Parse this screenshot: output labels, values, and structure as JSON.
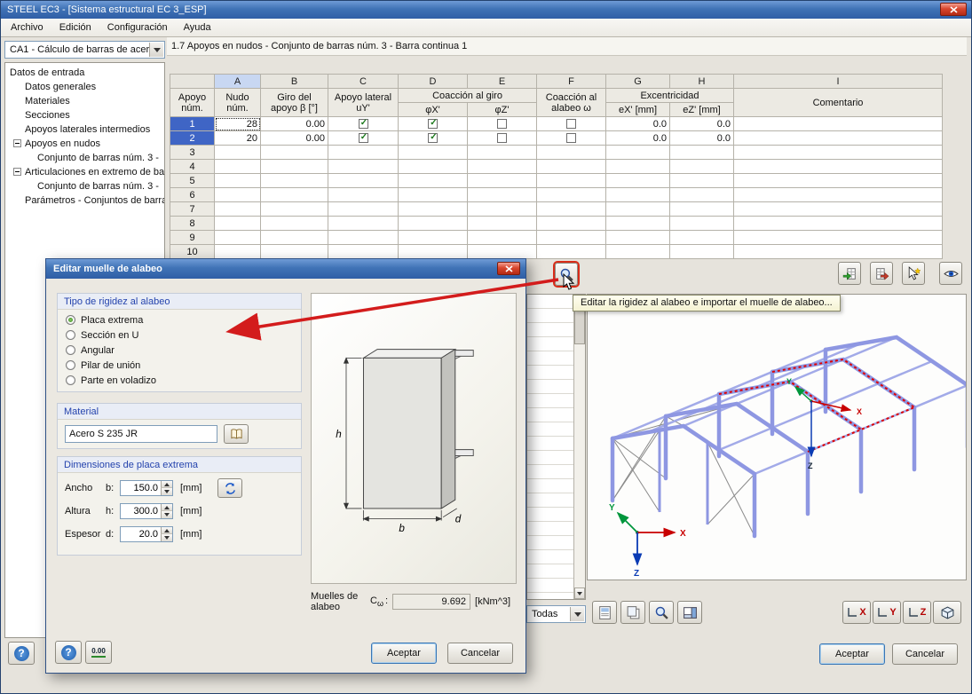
{
  "window": {
    "title": "STEEL EC3 - [Sistema estructural EC 3_ESP]"
  },
  "icons": {
    "help": "?"
  },
  "menu": {
    "items": [
      "Archivo",
      "Edición",
      "Configuración",
      "Ayuda"
    ]
  },
  "sidebar": {
    "case_selector": "CA1 - Cálculo de barras de acer",
    "tree_root": "Datos de entrada",
    "items": [
      {
        "label": "Datos generales"
      },
      {
        "label": "Materiales"
      },
      {
        "label": "Secciones"
      },
      {
        "label": "Apoyos laterales intermedios"
      },
      {
        "label": "Apoyos en nudos"
      },
      {
        "label": "Conjunto de barras núm. 3 -"
      },
      {
        "label": "Articulaciones en extremo de ba"
      },
      {
        "label": "Conjunto de barras núm. 3 -"
      },
      {
        "label": "Parámetros - Conjuntos de barra"
      }
    ]
  },
  "main": {
    "section_title": "1.7 Apoyos en nudos - Conjunto de barras núm. 3 - Barra continua 1",
    "filter_all": "Todas",
    "tooltip": "Editar la rigidez al alabeo e importar el muelle de alabeo...",
    "buttons": {
      "ok": "Aceptar",
      "cancel": "Cancelar"
    }
  },
  "table": {
    "letters": [
      "A",
      "B",
      "C",
      "D",
      "E",
      "F",
      "G",
      "H",
      "I"
    ],
    "headers": {
      "apoyo": [
        "Apoyo",
        "núm."
      ],
      "nudo": [
        "Nudo",
        "núm."
      ],
      "giro": [
        "Giro del",
        "apoyo β [°]"
      ],
      "lateral": [
        "Apoyo lateral",
        "uY'"
      ],
      "coaccion_giro": "Coacción al giro",
      "phi_x": "φX'",
      "phi_z": "φZ'",
      "alabeo": [
        "Coacción al",
        "alabeo ω"
      ],
      "excentricidad": "Excentricidad",
      "e_x": "eX' [mm]",
      "e_z": "eZ' [mm]",
      "comentario": "Comentario"
    },
    "rows": [
      {
        "num": "1",
        "nudo": "28",
        "giro": "0.00",
        "uy": true,
        "phix": true,
        "phiz": false,
        "omega": false,
        "ex": "0.0",
        "ez": "0.0",
        "comentario": ""
      },
      {
        "num": "2",
        "nudo": "20",
        "giro": "0.00",
        "uy": true,
        "phix": true,
        "phiz": false,
        "omega": false,
        "ex": "0.0",
        "ez": "0.0",
        "comentario": ""
      },
      {
        "num": "3"
      },
      {
        "num": "4"
      },
      {
        "num": "5"
      },
      {
        "num": "6"
      },
      {
        "num": "7"
      },
      {
        "num": "8"
      },
      {
        "num": "9"
      },
      {
        "num": "10"
      }
    ]
  },
  "viewer": {
    "axes": {
      "x": "X",
      "y": "Y",
      "z": "Z"
    },
    "view_buttons": {
      "x": "X",
      "y": "Y",
      "z": "Z"
    }
  },
  "dialog": {
    "title": "Editar muelle de alabeo",
    "stiffness_group": {
      "title": "Tipo de rigidez al alabeo",
      "options": [
        {
          "label": "Placa extrema",
          "selected": true
        },
        {
          "label": "Sección en U",
          "selected": false
        },
        {
          "label": "Angular",
          "selected": false
        },
        {
          "label": "Pilar de unión",
          "selected": false
        },
        {
          "label": "Parte en voladizo",
          "selected": false
        }
      ]
    },
    "material_group": {
      "title": "Material",
      "value": "Acero S 235 JR"
    },
    "dims_group": {
      "title": "Dimensiones de placa extrema",
      "rows": [
        {
          "label": "Ancho",
          "symbol": "b:",
          "value": "150.0",
          "unit": "[mm]"
        },
        {
          "label": "Altura",
          "symbol": "h:",
          "value": "300.0",
          "unit": "[mm]"
        },
        {
          "label": "Espesor",
          "symbol": "d:",
          "value": "20.0",
          "unit": "[mm]"
        }
      ]
    },
    "diagram": {
      "h": "h",
      "b": "b",
      "d": "d"
    },
    "result": {
      "label": "Muelles de alabeo",
      "symbol": "C",
      "symbol_sub": "ω",
      "colon": ":",
      "value": "9.692",
      "unit": "[kNm^3]"
    },
    "buttons": {
      "ok": "Aceptar",
      "cancel": "Cancelar",
      "zero": "0.00"
    }
  }
}
